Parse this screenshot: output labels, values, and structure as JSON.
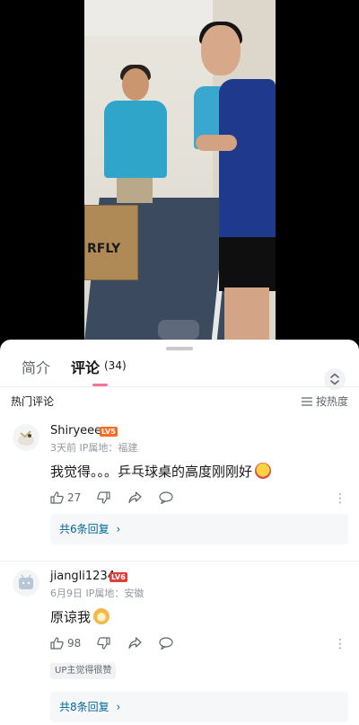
{
  "tabs": [
    {
      "label": "简介"
    },
    {
      "label": "评论",
      "count": "(34)"
    }
  ],
  "section": {
    "title": "热门评论",
    "sort_label": "按热度"
  },
  "colors": {
    "accent_pink": "#fb7299",
    "level_orange": "#ff6a1f",
    "level_red": "#e23d3d",
    "reply_link": "#00699d"
  },
  "video": {
    "box_text": "RFLY"
  },
  "comments": [
    {
      "user": "Shiryeee",
      "level": "LV5",
      "meta": "3天前  IP属地：福建",
      "text": "我觉得。。。乒乓球桌的高度刚刚好",
      "likes": "27",
      "replies_label": "共6条回复"
    },
    {
      "user": "jiangli1234",
      "level": "LV6",
      "meta": "6月9日  IP属地：安徽",
      "text": "原谅我",
      "likes": "98",
      "up_tag": "UP主觉得很赞",
      "replies_label": "共8条回复"
    }
  ],
  "icons": [
    "like-icon",
    "dislike-icon",
    "share-icon",
    "reply-icon",
    "more-icon",
    "sort-icon",
    "expand-icon",
    "chevron-right-icon"
  ]
}
